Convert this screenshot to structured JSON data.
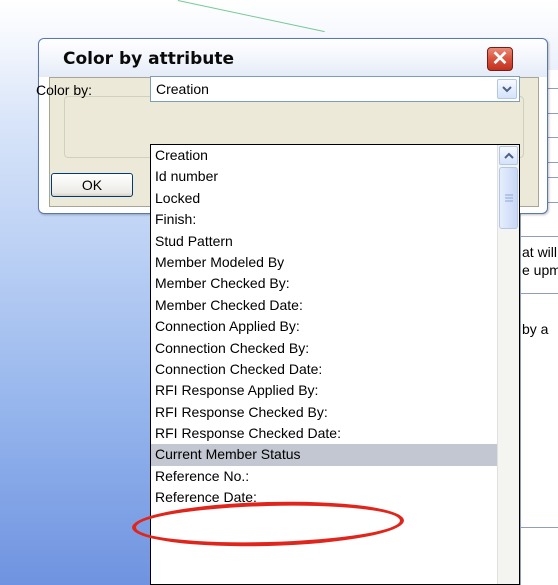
{
  "dialog": {
    "title": "Color by attribute",
    "color_by_label": "Color by:",
    "selected_value": "Creation",
    "ok_label": "OK"
  },
  "dropdown": {
    "options": [
      "Creation",
      "Id number",
      "Locked",
      "Finish:",
      "Stud Pattern",
      "Member Modeled By",
      "Member Checked By:",
      "Member Checked Date:",
      "Connection Applied By:",
      "Connection Checked By:",
      "Connection Checked Date:",
      "RFI Response Applied By:",
      "RFI Response Checked By:",
      "RFI Response Checked Date:",
      "Current Member Status",
      "Reference No.:",
      "Reference Date:"
    ],
    "highlighted_index": 14
  },
  "background": {
    "line1": "at will",
    "line2": "e upm",
    "line3": "by a"
  },
  "colors": {
    "annotation": "#e0261c",
    "highlight": "#c3c7d1",
    "close_button": "#d9523d"
  }
}
